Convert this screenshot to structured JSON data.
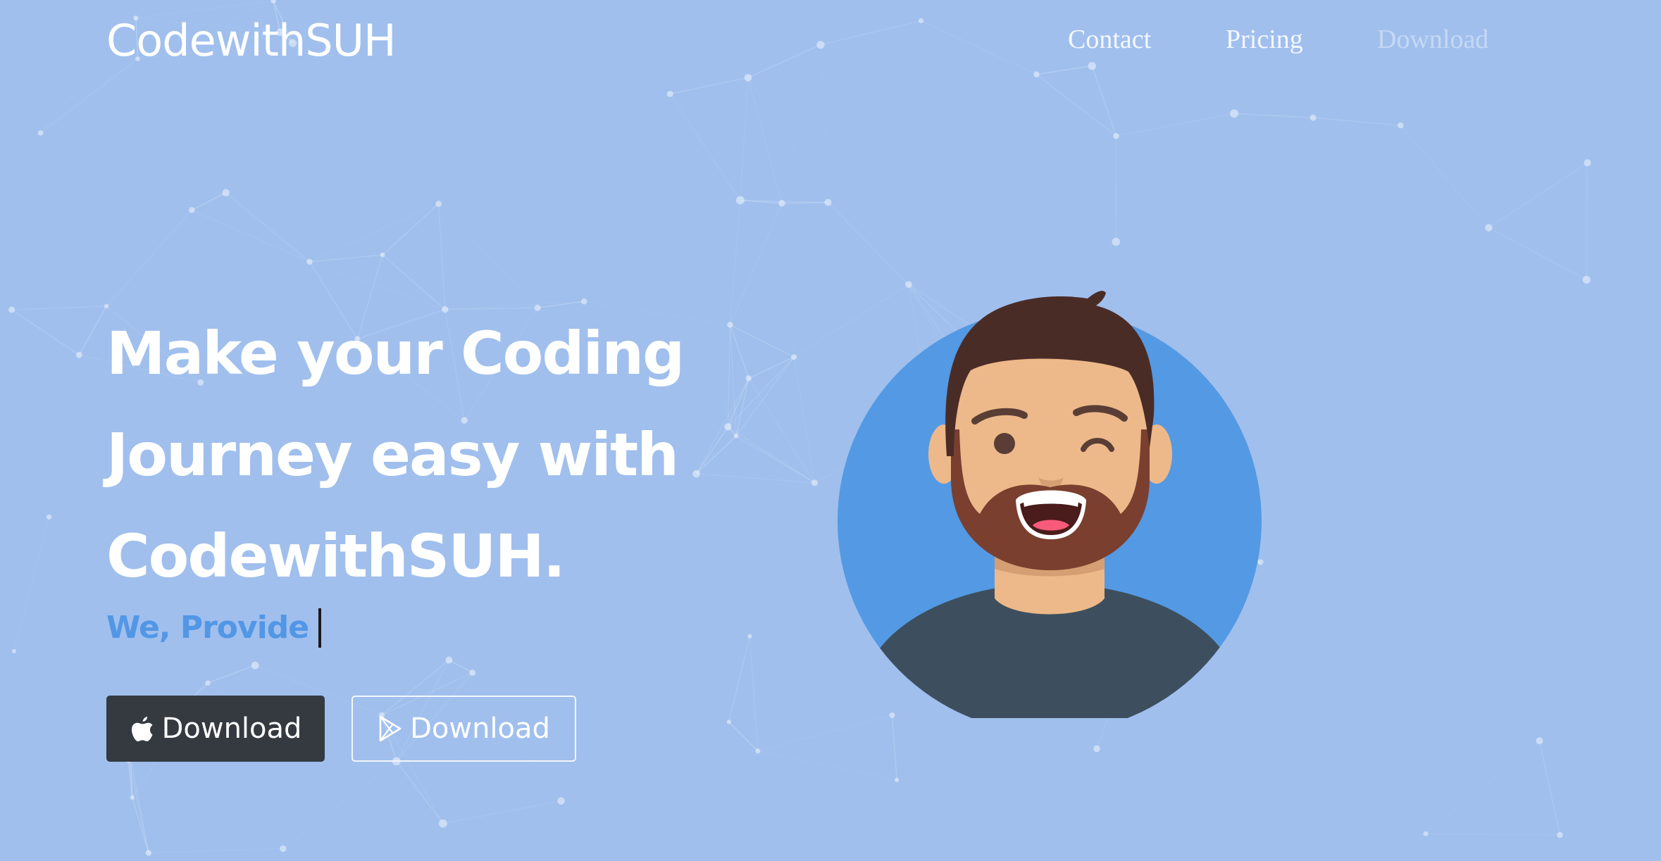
{
  "brand": {
    "name": "CodewithSUH"
  },
  "nav": {
    "items": [
      {
        "label": "Contact"
      },
      {
        "label": "Pricing"
      },
      {
        "label": "Download"
      }
    ]
  },
  "hero": {
    "headline_lines": [
      "Make your Coding",
      "Journey easy with",
      "CodewithSUH."
    ],
    "typed_prefix": "We, Provide",
    "buttons": [
      {
        "label": "Download",
        "icon": "apple-icon"
      },
      {
        "label": "Download",
        "icon": "google-play-icon"
      }
    ]
  },
  "colors": {
    "background": "#a0bfed",
    "accent_blue": "#5297e6",
    "dark_button": "#343a40",
    "avatar_circle": "#5499e3",
    "shirt": "#3d4f5e",
    "skin": "#edb98a",
    "hair": "#4a2c27",
    "beard": "#7a3f2f"
  }
}
